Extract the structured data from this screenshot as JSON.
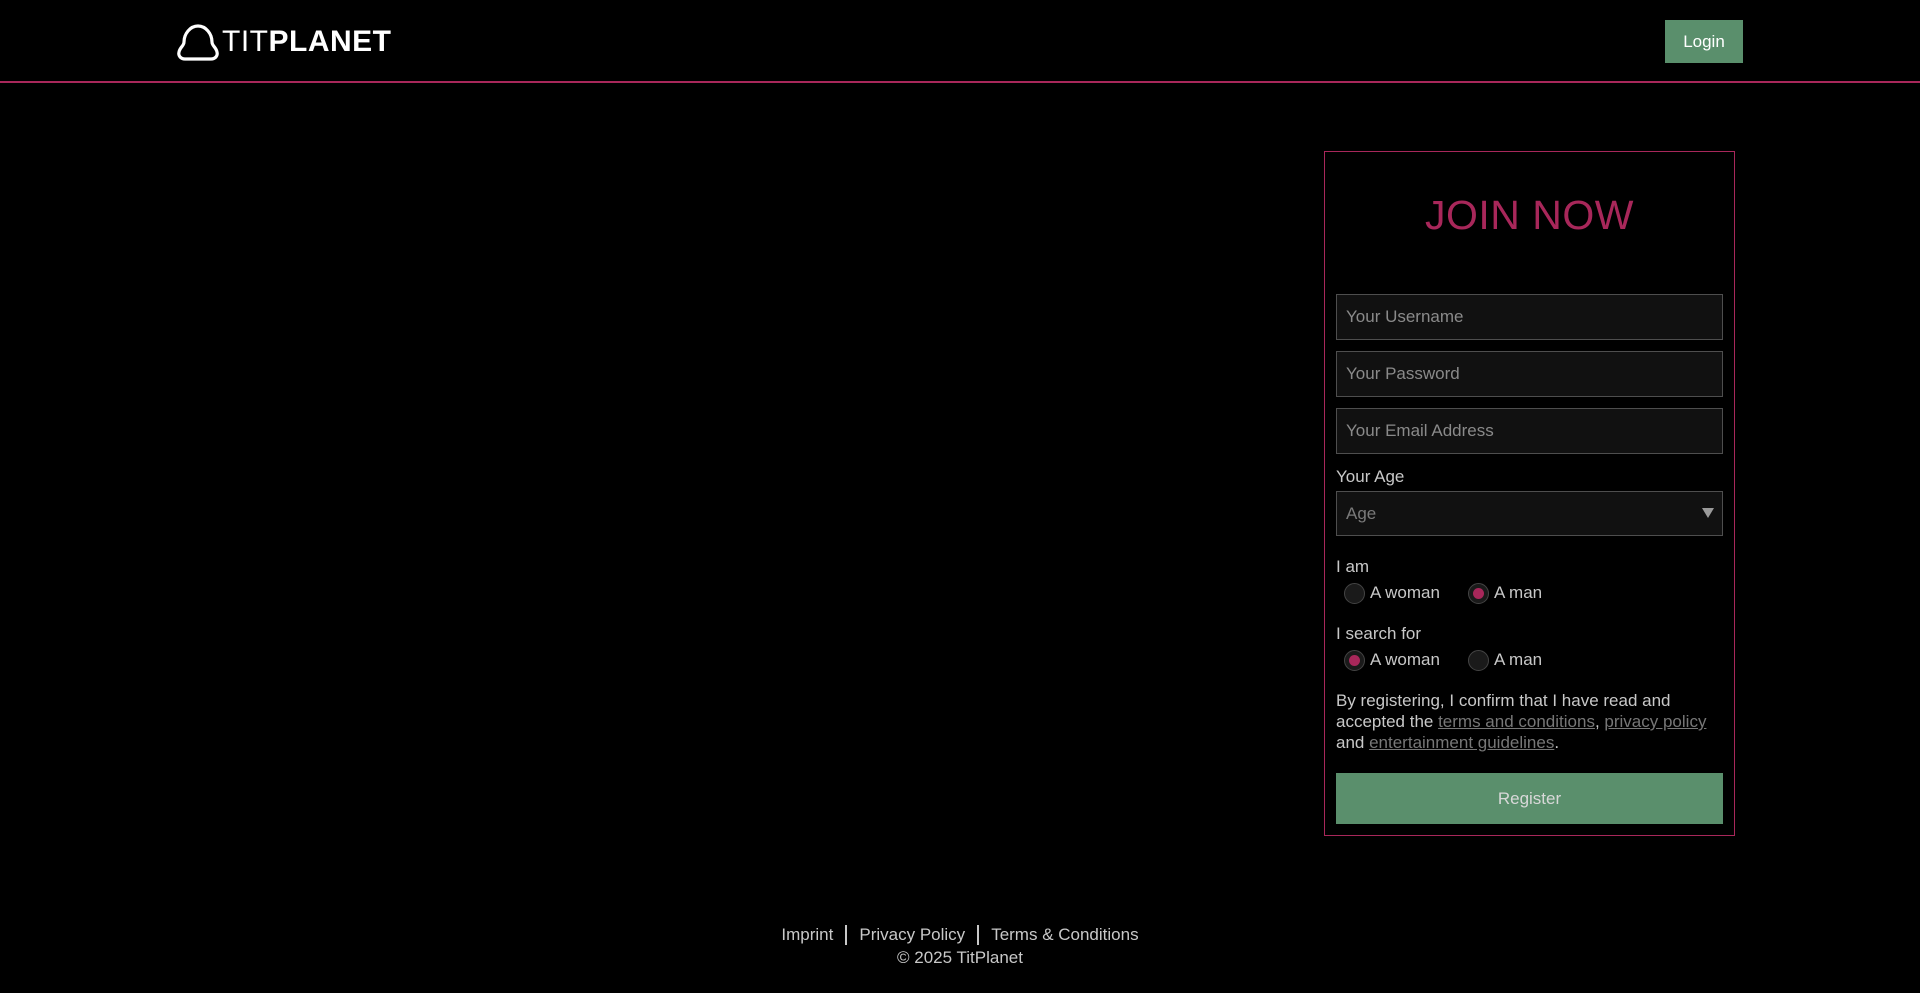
{
  "header": {
    "logo_light": "TIT",
    "logo_bold": "PLANET",
    "login_label": "Login"
  },
  "form": {
    "title": "JOIN NOW",
    "username_placeholder": "Your Username",
    "password_placeholder": "Your Password",
    "email_placeholder": "Your Email Address",
    "age_label": "Your Age",
    "age_value": "Age",
    "iam_label": "I am",
    "iam_options": [
      {
        "label": "A woman",
        "checked": false
      },
      {
        "label": "A man",
        "checked": true
      }
    ],
    "search_label": "I search for",
    "search_options": [
      {
        "label": "A woman",
        "checked": true
      },
      {
        "label": "A man",
        "checked": false
      }
    ],
    "terms_prefix": "By registering, I confirm that I have read and accepted the ",
    "terms_link": "terms and conditions",
    "terms_comma": ", ",
    "privacy_link": "privacy policy",
    "terms_and": " and ",
    "guidelines_link": "entertainment guidelines",
    "terms_end": ".",
    "register_label": "Register"
  },
  "footer": {
    "links": [
      "Imprint",
      "Privacy Policy",
      "Terms & Conditions"
    ],
    "copyright": "© 2025 TitPlanet"
  },
  "colors": {
    "accent": "#a8275a",
    "button_green": "#5a8f6c",
    "background": "#000000"
  }
}
